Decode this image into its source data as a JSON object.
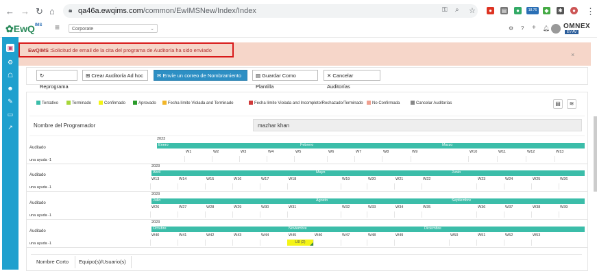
{
  "browser": {
    "url_host": "qa46a.ewqims.com",
    "url_path": "/common/EwIMSNew/Index/Index",
    "ext_badge": "18.76"
  },
  "header": {
    "logo_prefix": "Ew",
    "logo_q": "Q",
    "logo_ims": "IMS",
    "company": "Corporate",
    "brand": "OMNEX",
    "brand_sub": "EV-AV"
  },
  "alert": {
    "title": "EwQIMS :",
    "message": "Solicitud de email de la cita del programa de Auditoría ha sido enviado",
    "close": "×"
  },
  "toolbar": {
    "buttons": [
      "Reprograma",
      "Crear Auditoría Ad hoc",
      "Envíe un correo de Nombramiento",
      "Guardar Como Plantilla",
      "Cancelar Auditorías"
    ]
  },
  "legend": [
    {
      "label": "Tentativo",
      "color": "#3bbda9"
    },
    {
      "label": "Terminado",
      "color": "#a6d63a"
    },
    {
      "label": "Confirmado",
      "color": "#f4f416"
    },
    {
      "label": "Aprovado",
      "color": "#2a9b2a"
    },
    {
      "label": "Fecha límite Violada and Terminado",
      "color": "#f2b62a"
    },
    {
      "label": "Fecha límite Violada and Incompleto/Rechazado/Terminado",
      "color": "#d03a3a"
    },
    {
      "label": "No Confirmada",
      "color": "#f0a090"
    },
    {
      "label": "Cancelar Auditorías",
      "color": "#888888"
    }
  ],
  "programmer": {
    "label": "Nombre del Programador",
    "value": "mazhar khan"
  },
  "calendar": {
    "year": "2023",
    "row_label": "Auditado",
    "help_label": "una ayuda -1",
    "blocks": [
      {
        "months": [
          "Enero",
          "Febrero",
          "Marzo"
        ],
        "weeks": [
          "W1",
          "W2",
          "W3",
          "W4",
          "W5",
          "W6",
          "W7",
          "W8",
          "W9",
          "W10",
          "W11",
          "W12",
          "W13"
        ]
      },
      {
        "months": [
          "Abril",
          "Mayo",
          "Junio"
        ],
        "weeks": [
          "W13",
          "W14",
          "W15",
          "W16",
          "W17",
          "W18",
          "W19",
          "W20",
          "W21",
          "W22",
          "W23",
          "W24",
          "W25",
          "W26"
        ]
      },
      {
        "months": [
          "Julio",
          "Agosto",
          "Septiembre"
        ],
        "weeks": [
          "W26",
          "W27",
          "W28",
          "W29",
          "W30",
          "W31",
          "W32",
          "W33",
          "W34",
          "W35",
          "W36",
          "W37",
          "W38",
          "W39"
        ]
      },
      {
        "months": [
          "Octubre",
          "Noviembre",
          "Diciembre"
        ],
        "weeks": [
          "W40",
          "W41",
          "W42",
          "W43",
          "W44",
          "W45",
          "W46",
          "W47",
          "W48",
          "W49",
          "W50",
          "W51",
          "W52",
          "W53"
        ]
      }
    ],
    "scheduled_label": "U8 (2)"
  },
  "bottom_tabs": [
    "Nombre Corto",
    "Equipo(s)/Usuario(s)"
  ]
}
